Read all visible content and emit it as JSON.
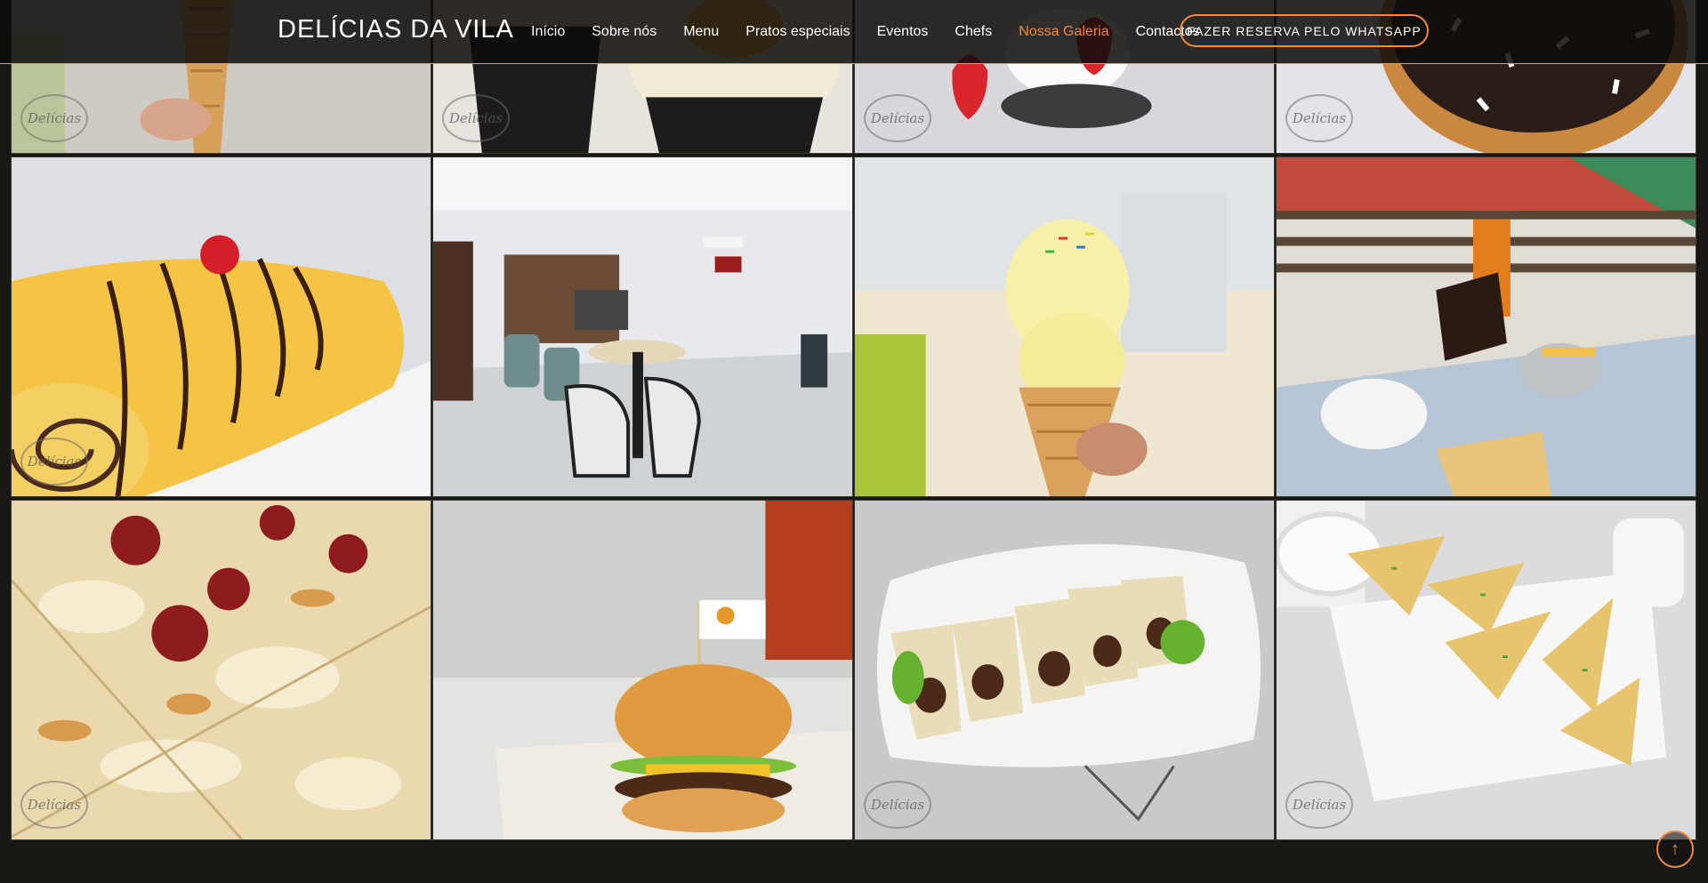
{
  "brand": "DELÍCIAS DA VILA",
  "nav": [
    "Início",
    "Sobre nós",
    "Menu",
    "Pratos especiais",
    "Eventos",
    "Chefs",
    "Nossa Galeria",
    "Contactos"
  ],
  "cta": "FAZER RESERVA PELO WHATSAPP",
  "watermark": "Delícias",
  "gallery": [
    {
      "name": "ice-cream-cone-photo",
      "watermark": true
    },
    {
      "name": "cupcakes-photo",
      "watermark": true
    },
    {
      "name": "strawberry-cupcakes-photo",
      "watermark": true
    },
    {
      "name": "chocolate-donut-photo",
      "watermark": true
    },
    {
      "name": "swiss-roll-cake-photo",
      "watermark": true
    },
    {
      "name": "cafe-interior-photo",
      "watermark": false
    },
    {
      "name": "ice-cream-cone-closeup-photo",
      "watermark": false
    },
    {
      "name": "terrace-breakfast-photo",
      "watermark": false
    },
    {
      "name": "pepperoni-pizza-photo",
      "watermark": true
    },
    {
      "name": "burger-photo",
      "watermark": false
    },
    {
      "name": "wraps-platter-photo",
      "watermark": true
    },
    {
      "name": "quesadillas-platter-photo",
      "watermark": true
    }
  ],
  "icons": {
    "back_to_top": "arrow-up-icon"
  },
  "colors": {
    "accent": "#f0893b",
    "header_bg": "#0e0c0a",
    "page_bg": "#1a1814",
    "gold_line": "#cda45e"
  }
}
